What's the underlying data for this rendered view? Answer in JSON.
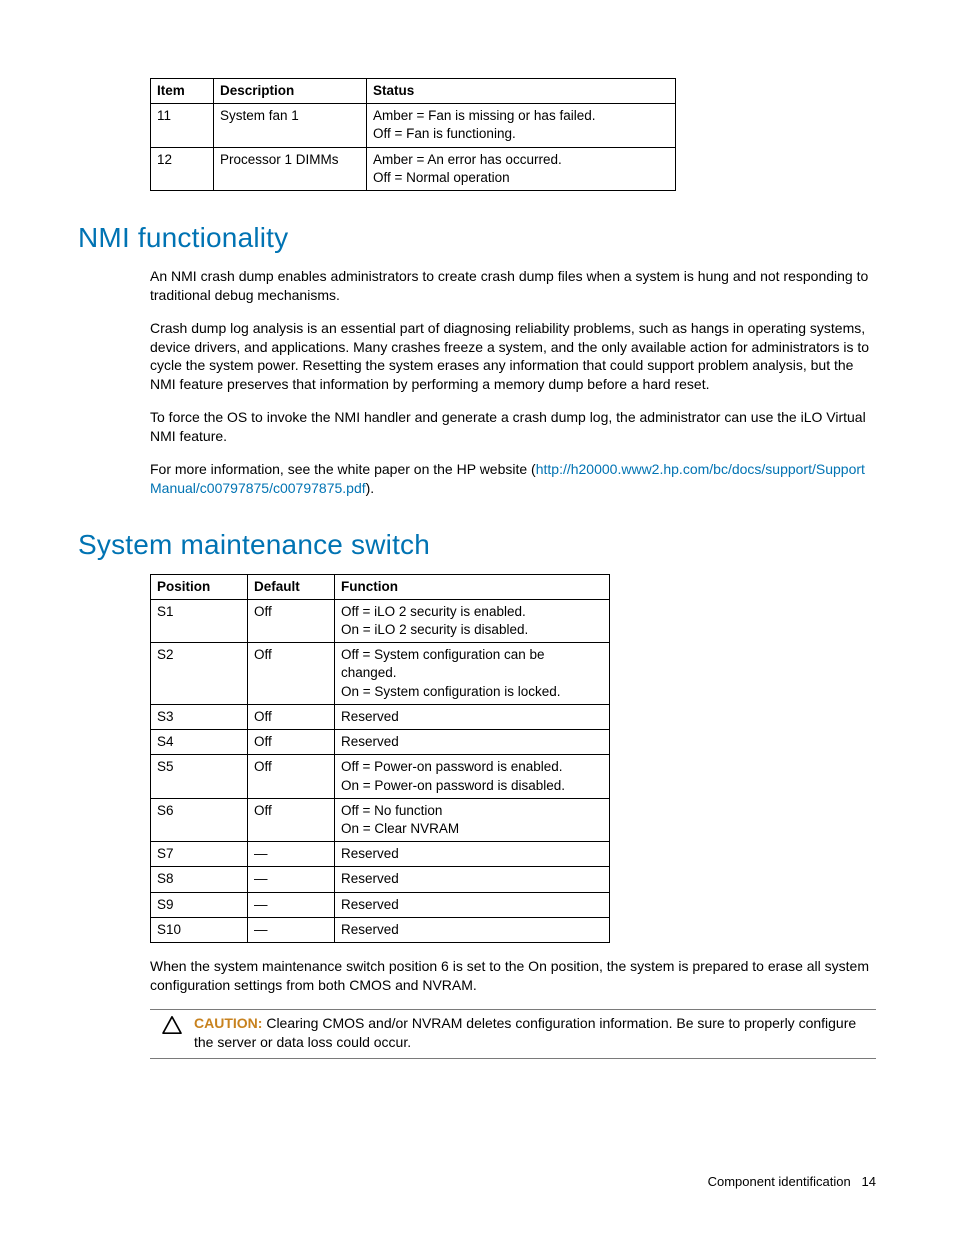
{
  "table1": {
    "headers": {
      "item": "Item",
      "description": "Description",
      "status": "Status"
    },
    "rows": [
      {
        "item": "11",
        "description": "System fan 1",
        "status": "Amber = Fan is missing or has failed.\nOff = Fan is functioning."
      },
      {
        "item": "12",
        "description": "Processor 1 DIMMs",
        "status": "Amber = An error has occurred.\nOff = Normal operation"
      }
    ]
  },
  "nmi": {
    "heading": "NMI functionality",
    "p1": "An NMI crash dump enables administrators to create crash dump files when a system is hung and not responding to traditional debug mechanisms.",
    "p2": "Crash dump log analysis is an essential part of diagnosing reliability problems, such as hangs in operating systems, device drivers, and applications. Many crashes freeze a system, and the only available action for administrators is to cycle the system power. Resetting the system erases any information that could support problem analysis, but the NMI feature preserves that information by performing a memory dump before a hard reset.",
    "p3": "To force the OS to invoke the NMI handler and generate a crash dump log, the administrator can use the iLO Virtual NMI feature.",
    "p4_pre": "For more information, see the white paper on the HP website (",
    "p4_link": "http://h20000.www2.hp.com/bc/docs/support/SupportManual/c00797875/c00797875.pdf",
    "p4_post": ")."
  },
  "sms": {
    "heading": "System maintenance switch",
    "headers": {
      "position": "Position",
      "default": "Default",
      "function": "Function"
    },
    "rows": [
      {
        "position": "S1",
        "default": "Off",
        "function": "Off = iLO 2 security is enabled.\nOn = iLO 2 security is disabled."
      },
      {
        "position": "S2",
        "default": "Off",
        "function": "Off = System configuration can be changed.\nOn = System configuration is locked."
      },
      {
        "position": "S3",
        "default": "Off",
        "function": "Reserved"
      },
      {
        "position": "S4",
        "default": "Off",
        "function": "Reserved"
      },
      {
        "position": "S5",
        "default": "Off",
        "function": "Off = Power-on password is enabled.\nOn = Power-on password is disabled."
      },
      {
        "position": "S6",
        "default": "Off",
        "function": "Off = No function\nOn = Clear NVRAM"
      },
      {
        "position": "S7",
        "default": "—",
        "function": "Reserved"
      },
      {
        "position": "S8",
        "default": "—",
        "function": "Reserved"
      },
      {
        "position": "S9",
        "default": "—",
        "function": "Reserved"
      },
      {
        "position": "S10",
        "default": "—",
        "function": "Reserved"
      }
    ],
    "note": "When the system maintenance switch position 6 is set to the On position, the system is prepared to erase all system configuration settings from both CMOS and NVRAM."
  },
  "caution": {
    "label": "CAUTION:",
    "text": "  Clearing CMOS and/or NVRAM deletes configuration information. Be sure to properly configure the server or data loss could occur."
  },
  "footer": {
    "section": "Component identification",
    "page": "14"
  }
}
